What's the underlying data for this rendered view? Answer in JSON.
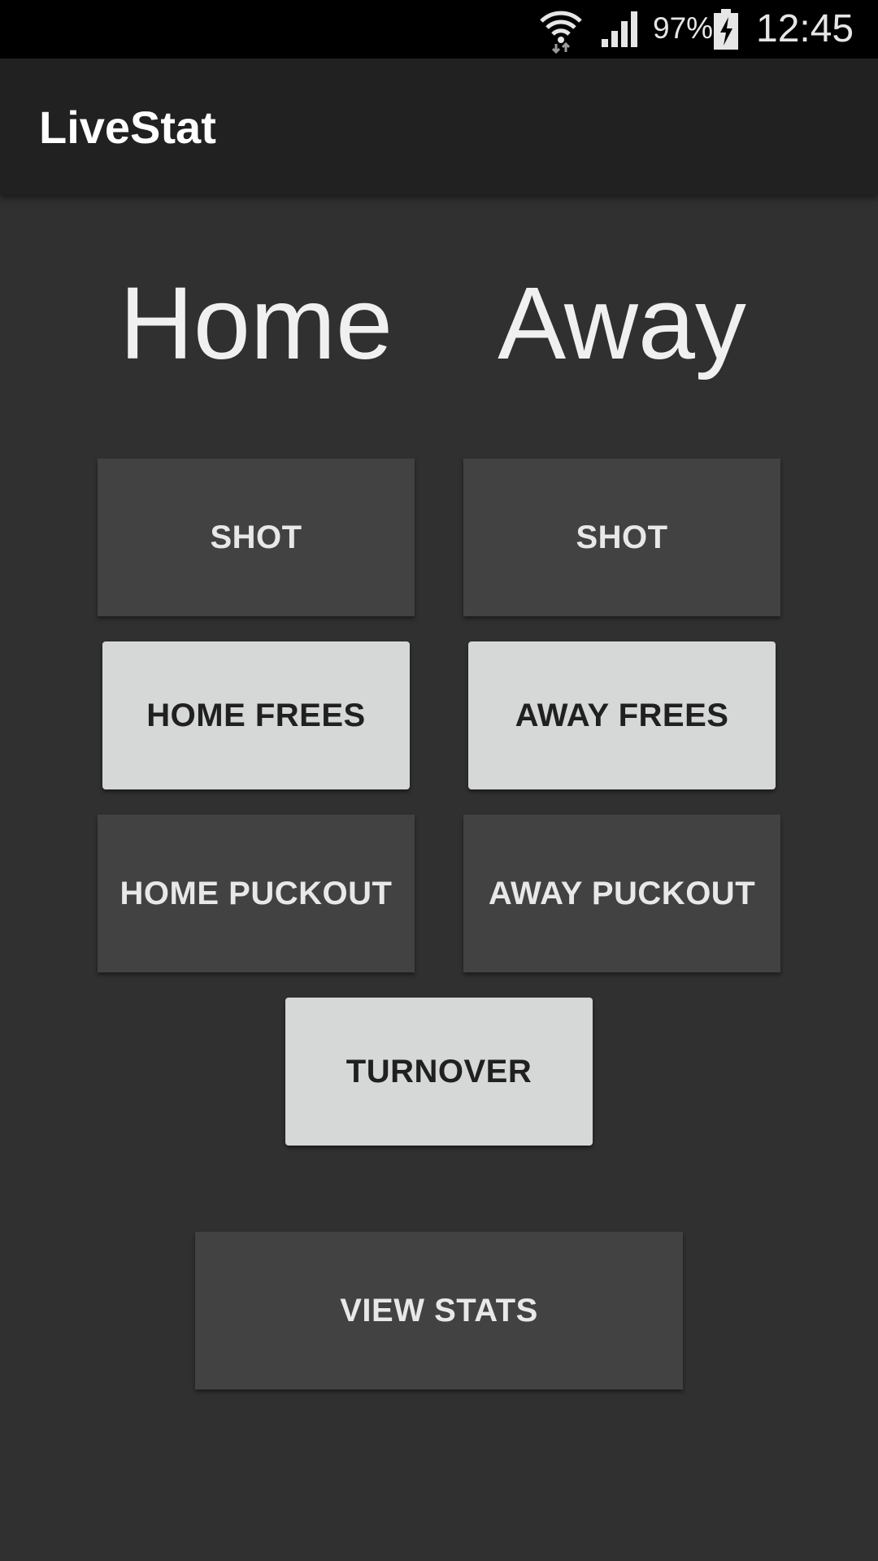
{
  "status_bar": {
    "battery_percent": "97%",
    "time": "12:45",
    "icons": [
      "wifi-icon",
      "cell-signal-icon",
      "battery-charging-icon"
    ]
  },
  "app_bar": {
    "title": "LiveStat"
  },
  "teams": {
    "home": "Home",
    "away": "Away"
  },
  "buttons": {
    "home_shot": "SHOT",
    "away_shot": "SHOT",
    "home_frees": "HOME FREES",
    "away_frees": "AWAY FREES",
    "home_puckout": "HOME PUCKOUT",
    "away_puckout": "AWAY PUCKOUT",
    "turnover": "TURNOVER",
    "view_stats": "VIEW STATS"
  },
  "colors": {
    "background": "#303030",
    "app_bar": "#212121",
    "status_bar": "#000000",
    "button_dark": "#424242",
    "button_light": "#d6d7d7"
  }
}
